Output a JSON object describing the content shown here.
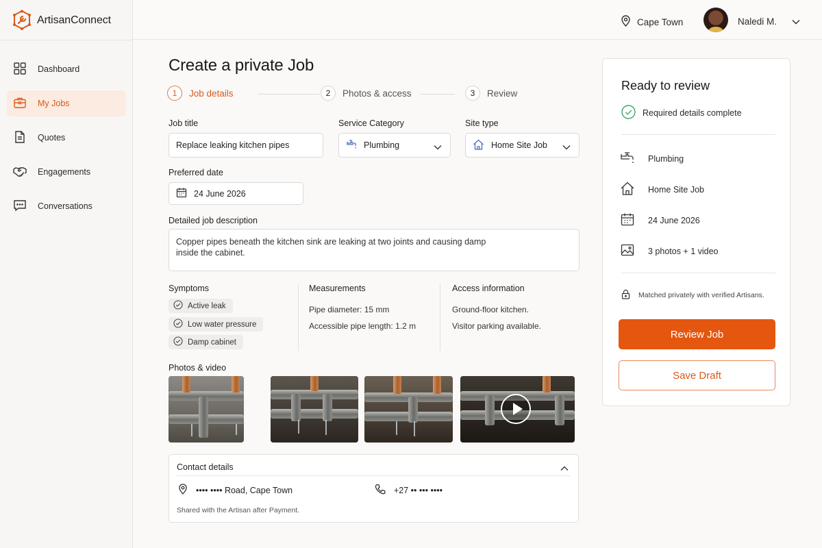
{
  "app": {
    "name": "ArtisanConnect",
    "accent": "#e5560f"
  },
  "sidebar": {
    "items": [
      {
        "label": "Dashboard",
        "icon": "grid-icon",
        "active": false
      },
      {
        "label": "My Jobs",
        "icon": "briefcase-icon",
        "active": true
      },
      {
        "label": "Quotes",
        "icon": "document-icon",
        "active": false
      },
      {
        "label": "Engagements",
        "icon": "handshake-icon",
        "active": false
      },
      {
        "label": "Conversations",
        "icon": "chat-icon",
        "active": false
      }
    ]
  },
  "topbar": {
    "location": "Cape Town",
    "user_name": "Naledi M."
  },
  "main": {
    "title": "Create a private Job",
    "steps": [
      {
        "num": "1",
        "label": "Job details",
        "active": true
      },
      {
        "num": "2",
        "label": "Photos & access",
        "active": false
      },
      {
        "num": "3",
        "label": "Review",
        "active": false
      }
    ],
    "form": {
      "job_title_label": "Job title",
      "job_title_value": "Replace leaking kitchen pipes",
      "service_category_label": "Service Category",
      "service_category_value": "Plumbing",
      "site_type_label": "Site type",
      "site_type_value": "Home Site Job",
      "preferred_date_label": "Preferred date",
      "preferred_date_value": "24 June 2026",
      "description_label": "Detailed job description",
      "description_line1": "Copper pipes beneath the kitchen sink are leaking at two joints and causing damp",
      "description_line2": "inside the cabinet."
    },
    "symptoms": {
      "label": "Symptoms",
      "items": [
        "Active leak",
        "Low water pressure",
        "Damp cabinet"
      ]
    },
    "measurements": {
      "label": "Measurements",
      "lines": [
        "Pipe diameter: 15 mm",
        "Accessible pipe length: 1.2 m"
      ]
    },
    "access": {
      "label": "Access information",
      "lines": [
        "Ground-floor kitchen.",
        "Visitor parking available."
      ]
    },
    "media": {
      "label": "Photos & video"
    },
    "contact": {
      "label": "Contact details",
      "address": "•••• •••• Road, Cape Town",
      "phone": "+27 •• ••• ••••",
      "note": "Shared with the Artisan after Payment."
    }
  },
  "panel": {
    "title": "Ready to review",
    "status": "Required details complete",
    "summary": [
      {
        "icon": "faucet-icon",
        "text": "Plumbing"
      },
      {
        "icon": "home-icon",
        "text": "Home Site Job"
      },
      {
        "icon": "calendar-icon",
        "text": "24 June 2026"
      },
      {
        "icon": "image-icon",
        "text": "3 photos + 1 video"
      }
    ],
    "privacy_note": "Matched privately with verified Artisans.",
    "primary_button": "Review Job",
    "secondary_button": "Save Draft"
  }
}
